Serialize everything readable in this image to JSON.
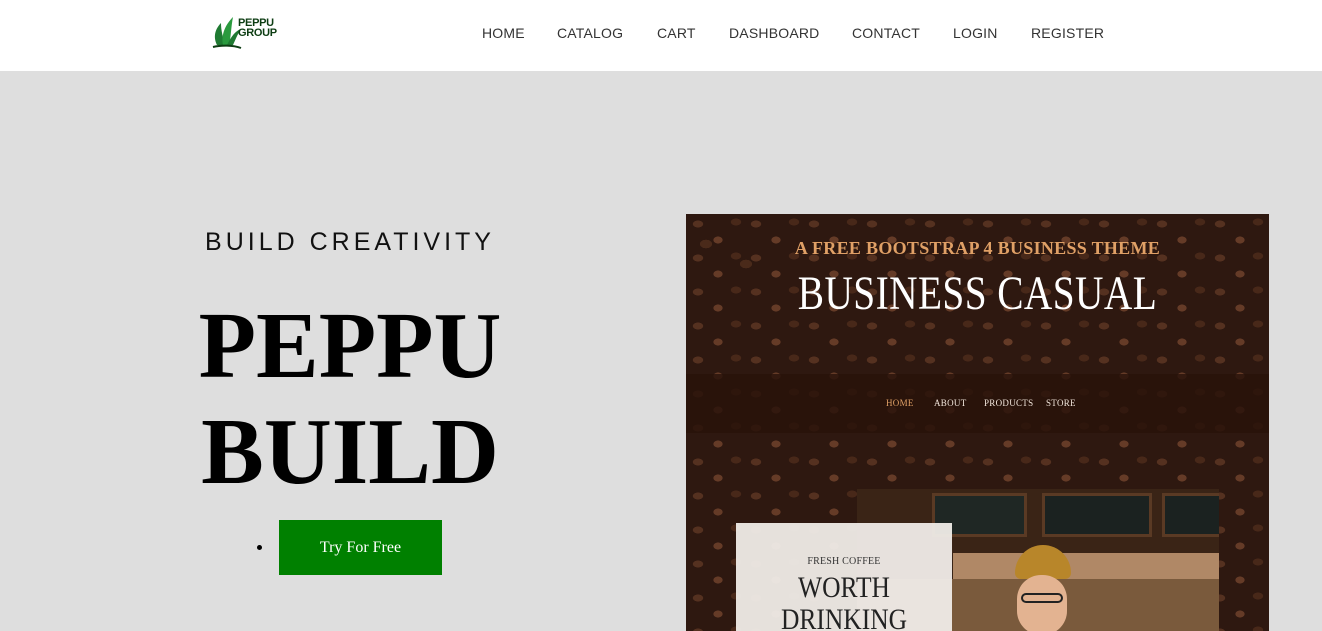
{
  "brand": {
    "logo_text_line1": "PEPPU",
    "logo_text_line2": "GROUP"
  },
  "nav": {
    "items": [
      {
        "label": "HOME"
      },
      {
        "label": "CATALOG"
      },
      {
        "label": "CART"
      },
      {
        "label": "DASHBOARD"
      },
      {
        "label": "CONTACT"
      },
      {
        "label": "LOGIN"
      },
      {
        "label": "REGISTER"
      }
    ]
  },
  "hero": {
    "kicker": "BUILD CREATIVITY",
    "title_line1": "PEPPU",
    "title_line2": "BUILD",
    "cta_label": "Try For Free"
  },
  "preview": {
    "subtitle": "A FREE BOOTSTRAP 4 BUSINESS THEME",
    "title": "BUSINESS CASUAL",
    "nav": [
      {
        "label": "HOME"
      },
      {
        "label": "ABOUT"
      },
      {
        "label": "PRODUCTS"
      },
      {
        "label": "STORE"
      }
    ],
    "card_kicker": "FRESH COFFEE",
    "card_title_line1": "WORTH",
    "card_title_line2": "DRINKING"
  },
  "colors": {
    "cta_bg": "#008000",
    "page_bg": "#dedede",
    "preview_accent": "#e0a066",
    "brand_green": "#0d3d13"
  }
}
